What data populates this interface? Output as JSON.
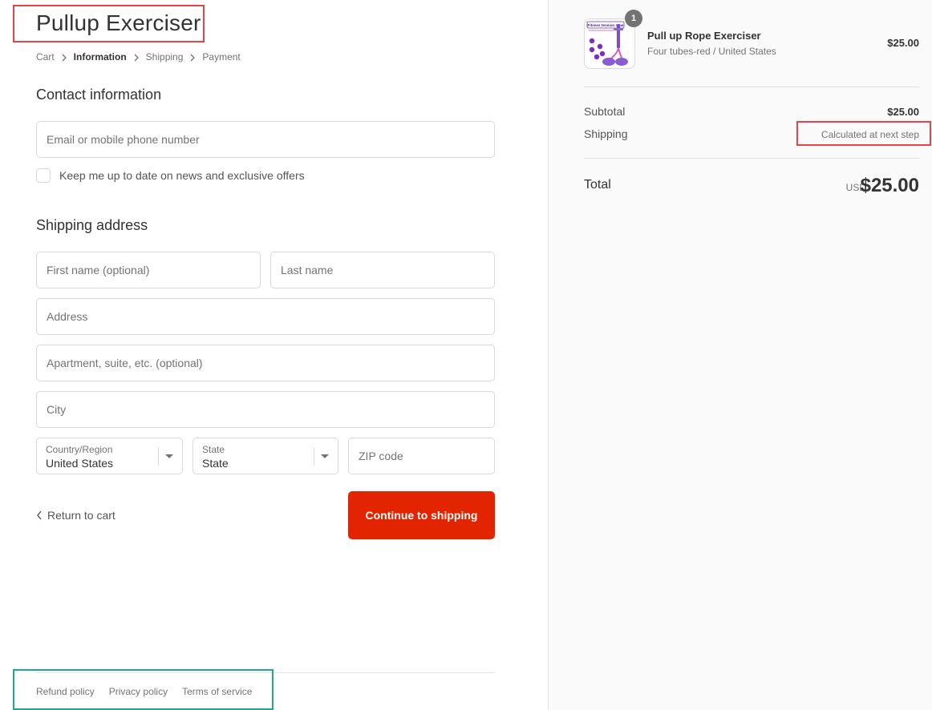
{
  "store": {
    "title": "Pullup Exerciser"
  },
  "breadcrumb": [
    {
      "label": "Cart"
    },
    {
      "label": "Information"
    },
    {
      "label": "Shipping"
    },
    {
      "label": "Payment"
    }
  ],
  "contact": {
    "heading": "Contact information",
    "email_placeholder": "Email or mobile phone number",
    "newsletter_label": "Keep me up to date on news and exclusive offers"
  },
  "shipping_address": {
    "heading": "Shipping address",
    "first_name_placeholder": "First name (optional)",
    "last_name_placeholder": "Last name",
    "address_placeholder": "Address",
    "apartment_placeholder": "Apartment, suite, etc. (optional)",
    "city_placeholder": "City",
    "country_label": "Country/Region",
    "country_value": "United States",
    "state_label": "State",
    "state_value": "State",
    "zip_placeholder": "ZIP code"
  },
  "actions": {
    "return_label": "Return to cart",
    "continue_label": "Continue to shipping"
  },
  "footer": {
    "links": [
      "Refund policy",
      "Privacy policy",
      "Terms of service"
    ]
  },
  "order": {
    "product_name": "Pull up Rope Exerciser",
    "product_variant": "Four tubes-red / United States",
    "product_price": "$25.00",
    "quantity": "1",
    "thumbnail_text": "Fitness tension rope",
    "subtotal_label": "Subtotal",
    "subtotal_value": "$25.00",
    "shipping_label": "Shipping",
    "shipping_value": "Calculated at next step",
    "total_label": "Total",
    "total_currency": "USD",
    "total_value": "$25.00"
  },
  "colors": {
    "primary_button": "#e22500",
    "highlight_red": "#e8424d",
    "highlight_teal": "#1fa88f"
  }
}
